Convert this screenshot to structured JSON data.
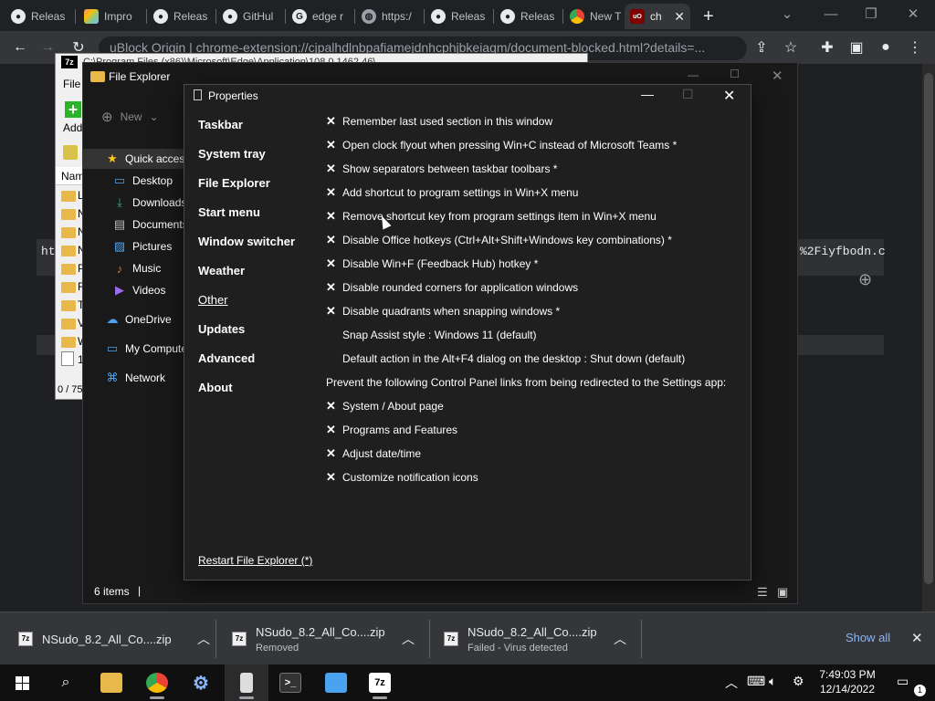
{
  "browser": {
    "tabs": [
      {
        "label": "Releas",
        "icon": "github-icon"
      },
      {
        "label": "Impro",
        "icon": "colorful-app-icon"
      },
      {
        "label": "Releas",
        "icon": "github-icon"
      },
      {
        "label": "GitHul",
        "icon": "github-icon"
      },
      {
        "label": "edge r",
        "icon": "google-icon"
      },
      {
        "label": "https:/",
        "icon": "globe-icon"
      },
      {
        "label": "Releas",
        "icon": "github-icon"
      },
      {
        "label": "Releas",
        "icon": "github-icon"
      },
      {
        "label": "New T",
        "icon": "chrome-icon"
      },
      {
        "label": "ch",
        "icon": "ublock-icon"
      }
    ],
    "address": "uBlock Origin  |  chrome-extension://cjpalhdlnbpafiamejdnhcphjbkeiagm/document-blocked.html?details=...",
    "page_url_left": "ht",
    "page_url_right": "%2Fiyfbodn.c"
  },
  "zip_window": {
    "title": "C:\\Program Files (x86)\\Microsoft\\Edge\\Application\\108.0.1462.46\\",
    "logo": "7z",
    "menu_file": "File",
    "add_label": "Add",
    "column_name": "Nam",
    "rows": [
      "L",
      "N",
      "N",
      "N",
      "P",
      "R",
      "T",
      "V",
      "W",
      "1"
    ],
    "status": "0 / 75"
  },
  "file_explorer": {
    "title": "File Explorer",
    "new_label": "New",
    "nav": [
      {
        "label": "Quick access",
        "icon": "star-icon"
      },
      {
        "label": "Desktop",
        "icon": "desktop-icon"
      },
      {
        "label": "Downloads",
        "icon": "download-icon"
      },
      {
        "label": "Documents",
        "icon": "document-icon"
      },
      {
        "label": "Pictures",
        "icon": "pictures-icon"
      },
      {
        "label": "Music",
        "icon": "music-icon"
      },
      {
        "label": "Videos",
        "icon": "videos-icon"
      },
      {
        "label": "OneDrive",
        "icon": "cloud-icon"
      },
      {
        "label": "My Computer",
        "icon": "computer-icon"
      },
      {
        "label": "Network",
        "icon": "network-icon"
      }
    ],
    "status": "6 items"
  },
  "properties": {
    "title": "Properties",
    "nav": [
      "Taskbar",
      "System tray",
      "File Explorer",
      "Start menu",
      "Window switcher",
      "Weather",
      "Other",
      "Updates",
      "Advanced",
      "About"
    ],
    "selected_nav": "Other",
    "options": [
      {
        "label": "Remember last used section in this window",
        "checked": true
      },
      {
        "label": "Open clock flyout when pressing Win+C instead of Microsoft Teams *",
        "checked": true
      },
      {
        "label": "Show separators between taskbar toolbars *",
        "checked": true
      },
      {
        "label": "Add shortcut to program settings in Win+X menu",
        "checked": true
      },
      {
        "label": "Remove shortcut key from program settings item in Win+X menu",
        "checked": true
      },
      {
        "label": "Disable Office hotkeys (Ctrl+Alt+Shift+Windows key combinations) *",
        "checked": true
      },
      {
        "label": "Disable Win+F (Feedback Hub) hotkey *",
        "checked": true
      },
      {
        "label": "Disable rounded corners for application windows",
        "checked": true
      },
      {
        "label": "Disable quadrants when snapping windows *",
        "checked": true
      }
    ],
    "snap_assist": "Snap Assist style : Windows 11 (default)",
    "default_action": "Default action in the Alt+F4 dialog on the desktop : Shut down (default)",
    "prevent_heading": "Prevent the following Control Panel links from being redirected to the Settings app:",
    "control_panel_links": [
      {
        "label": "System / About page",
        "checked": true
      },
      {
        "label": "Programs and Features",
        "checked": true
      },
      {
        "label": "Adjust date/time",
        "checked": true
      },
      {
        "label": "Customize notification icons",
        "checked": true
      }
    ],
    "restart_link": "Restart File Explorer (*)"
  },
  "downloads": {
    "items": [
      {
        "name": "NSudo_8.2_All_Co....zip",
        "status": ""
      },
      {
        "name": "NSudo_8.2_All_Co....zip",
        "status": "Removed"
      },
      {
        "name": "NSudo_8.2_All_Co....zip",
        "status": "Failed - Virus detected"
      }
    ],
    "show_all": "Show all"
  },
  "taskbar": {
    "time": "7:49:03 PM",
    "date": "12/14/2022",
    "notification_count": "1",
    "sevenzip_label": "7z"
  },
  "colors": {
    "chrome_dark": "#202124",
    "chrome_toolbar": "#35363a",
    "dialog_bg": "#1f1f1f",
    "link_blue": "#8ab4f8"
  }
}
